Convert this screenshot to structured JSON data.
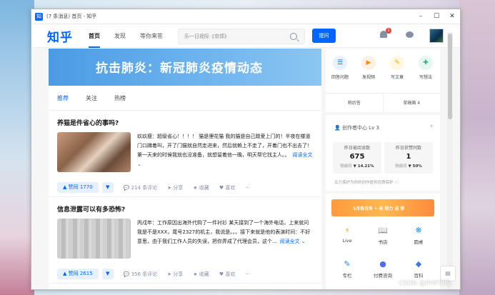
{
  "window": {
    "title": "(7 条消息) 首页 - 知乎",
    "controls": [
      "–",
      "☐",
      "✕"
    ]
  },
  "nav": {
    "logo": "知乎",
    "links": [
      "首页",
      "发现",
      "等你来答"
    ],
    "search_placeholder": "乐一日视际《京郊》",
    "ask_label": "提问",
    "notification_count": "2"
  },
  "banner": {
    "text": "抗击肺炎：新冠肺炎疫情动态"
  },
  "feed_tabs": [
    "推荐",
    "关注",
    "热榜"
  ],
  "cards": [
    {
      "title": "养猫是件省心的事吗?",
      "body": "玖玖瘦：超级省心！！！！ 猫是狸花猫 我的猫是自己蹭爱上门的！半夜在楼道门口蹲着叫，开了门猫就自然走进来，然后就赖上不走了，开着门也不出去了！ 第一天来的时候我就也没准备，就想留着他一晚，明天帮它找主人。。",
      "more": "阅读全文 ⌄",
      "vote": "▲ 赞同 1770",
      "comments": "214 条评论",
      "share": "分享",
      "favorite": "收藏",
      "like": "喜欢",
      "dots": "···"
    },
    {
      "title": "信息泄露可以有多恐怖?",
      "body": "丙戍年：工作原因出海外代购了一件衬衫 某天接到了一个海外电话，上来就问我是不是XXX，尾号2327的机主，我说是。。。接下来就是他的表演时间：不好意思，由于我们工作人员的失误，把你弄成了代理会员，这个...",
      "more": "阅读全文 ⌄",
      "vote": "▲ 赞同 2615",
      "comments": "356 条评论",
      "share": "分享",
      "favorite": "收藏",
      "like": "喜欢",
      "dots": "···"
    }
  ],
  "create": {
    "items": [
      "回答问题",
      "发视频",
      "写文章",
      "写想法"
    ],
    "row": [
      "稍后答",
      "草稿箱 4"
    ]
  },
  "creator": {
    "header": "创作者中心  Lv 3",
    "arrow": "›",
    "stats": [
      {
        "label": "昨日被阅读数",
        "value": "675",
        "delta_label": "较前日",
        "delta": "▼ 14.21%"
      },
      {
        "label": "昨日获赞同数",
        "value": "1",
        "delta_label": "较前日",
        "delta": "▼ 50%"
      }
    ],
    "note": "五力保护为你的创作提供优质保护 ⓘ"
  },
  "promo": {
    "text": "5月各位冬 • 来 努力 进 新"
  },
  "tools": [
    [
      "Live",
      "书店",
      "圆桌"
    ],
    [
      "专栏",
      "付费咨询",
      "百科"
    ]
  ],
  "tool_icons": [
    [
      "⚡",
      "📖",
      "❋"
    ],
    [
      "✎",
      "●",
      "◆"
    ]
  ],
  "watermark": "CSDN @PHP代码",
  "colors": {
    "brand": "#0066ff",
    "banner": "#5aa7ea",
    "badge": "#f1403c"
  }
}
